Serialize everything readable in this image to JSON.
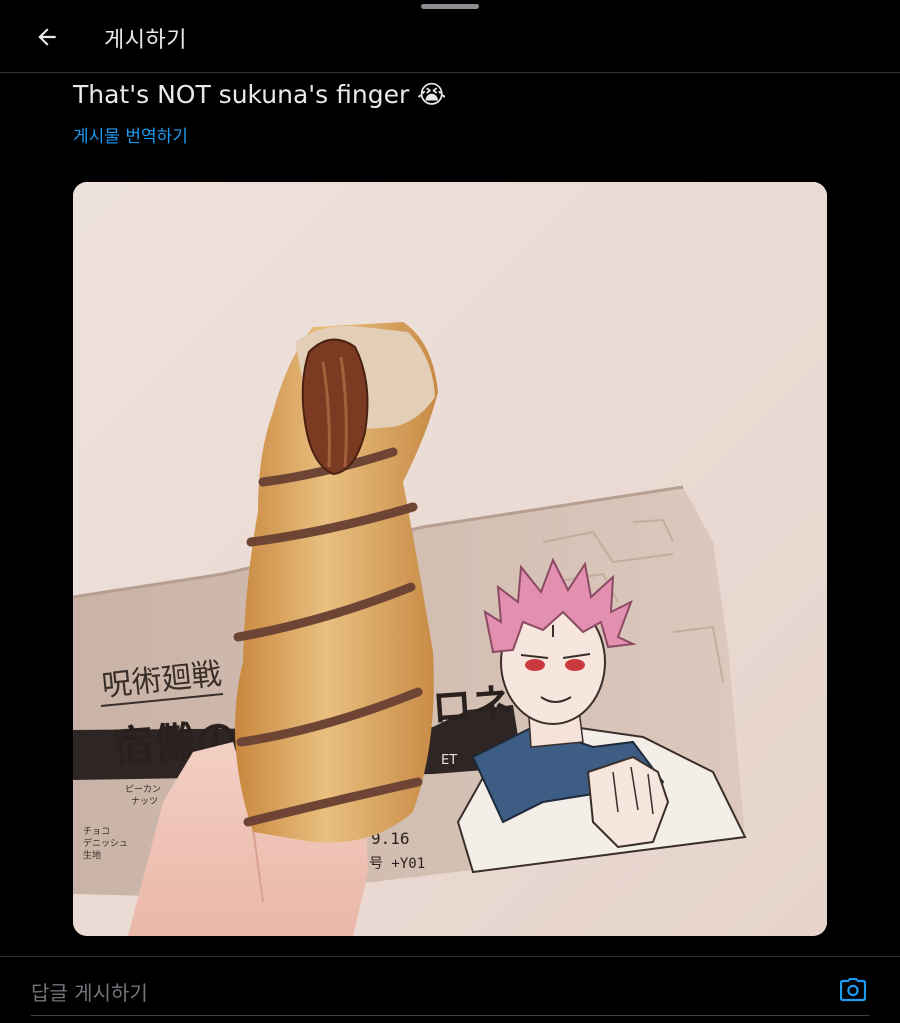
{
  "header": {
    "title": "게시하기",
    "back_icon": "arrow-left-icon"
  },
  "post": {
    "text": "That's NOT sukuna's finger 😭",
    "translate_label": "게시물 번역하기",
    "accent_color": "#1d9bf0"
  },
  "media": {
    "package_labels": {
      "logo_text": "呪術廻戦",
      "product_name_left": "宿儺の",
      "product_name_right": "ロネ",
      "subtitle_fragment": "ET",
      "ingredients": [
        "ピーカン",
        "ナッツ",
        "チョコ",
        "デニッシュ",
        "生地"
      ],
      "date": "9.16",
      "code": "号 +Y01"
    }
  },
  "reply": {
    "placeholder": "답글 게시하기",
    "camera_icon": "camera-icon"
  }
}
